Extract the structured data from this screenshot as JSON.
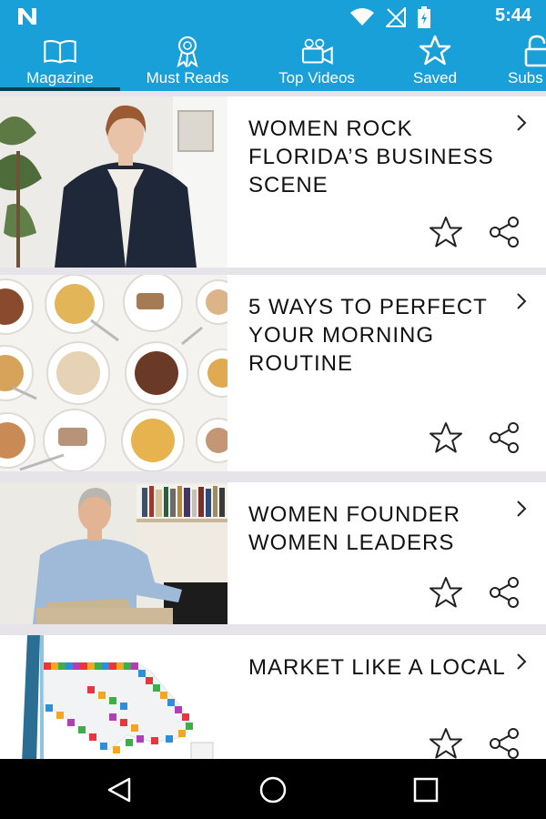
{
  "status_bar": {
    "time": "5:44",
    "icons": [
      "n-logo-icon",
      "wifi-icon",
      "no-signal-icon",
      "battery-icon"
    ],
    "background": "#1aa0d8"
  },
  "tabs": [
    {
      "label": "Magazine",
      "icon": "book-icon",
      "selected": true
    },
    {
      "label": "Must Reads",
      "icon": "award-ribbon-icon",
      "selected": false
    },
    {
      "label": "Top Videos",
      "icon": "video-camera-icon",
      "selected": false
    },
    {
      "label": "Saved",
      "icon": "star-icon",
      "selected": false
    },
    {
      "label": "Subs",
      "icon": "lock-icon",
      "selected": false
    }
  ],
  "articles": [
    {
      "title": "WOMEN ROCK FLORIDA’S BUSINESS SCENE",
      "image": "woman-in-blazer-photo"
    },
    {
      "title": "5 WAYS TO PERFECT YOUR MORNING ROUTINE",
      "image": "cereal-bowls-photo"
    },
    {
      "title": "WOMEN FOUNDER WOMEN LEADERS",
      "image": "man-in-blue-shirt-photo"
    },
    {
      "title": "MARKET LIKE A LOCAL",
      "image": "pixel-hand-cursor-illustration"
    }
  ],
  "nav_bar": {
    "buttons": [
      "back-icon",
      "home-icon",
      "recents-icon"
    ]
  },
  "colors": {
    "accent": "#1aa0d8",
    "indicator": "#0a3c57",
    "divider": "#e6e4e8"
  }
}
